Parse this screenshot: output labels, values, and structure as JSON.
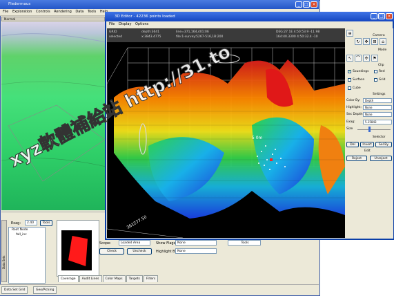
{
  "back_window": {
    "title": "Fledermaus",
    "menu": [
      "File",
      "Exploration",
      "Controls",
      "Rendering",
      "Data",
      "Tools",
      "Help"
    ],
    "strip_label": "Normal"
  },
  "bottom_panel": {
    "exag_label": "Exag:",
    "exag_value": "2.40",
    "tools_button": "Tools",
    "tree_items": [
      "Root Node",
      "fall_inc"
    ],
    "scope_label": "Scope:",
    "scope_value": "Loaded Area",
    "check_button": "Check",
    "uncheck_button": "Uncheck",
    "show_flags_label": "Show Flags:",
    "show_flags_value": "None",
    "highlight_by_label": "Highlight By:",
    "highlight_by_value": "None",
    "tools_dropdown": "Tools",
    "tabs": [
      "Coverage",
      "Audit Lines",
      "Color Maps",
      "Targets",
      "Filters"
    ],
    "side_tab_label": "Data Sets"
  },
  "status_tabs": [
    "Data Set Grid",
    "Geo/Picking"
  ],
  "front_window": {
    "title": "3D Editor - 42236 points loaded",
    "menu": [
      "File",
      "Display",
      "Options"
    ],
    "info": {
      "col1": [
        "GRID",
        "selected"
      ],
      "col2": [
        "depth:3641",
        "x:3843.4775"
      ],
      "col3": [
        "line=371,164,401:06",
        "file:1-survey:5267-516,1B:200"
      ],
      "col4": [
        "DEG:27.1E 4:50:53.9 -11.98",
        "164:40.3300 4:50:32.4 -10"
      ]
    },
    "depth_label": "5 0m",
    "bottom_axis_label": "361277.50"
  },
  "side_panel": {
    "camera_label": "Camera",
    "mode_label": "Mode",
    "clip_label": "Clip",
    "checkboxes": [
      {
        "label": "Soundings",
        "checked": true
      },
      {
        "label": "Red",
        "checked": false
      },
      {
        "label": "Surface",
        "checked": false
      },
      {
        "label": "Grid",
        "checked": false
      },
      {
        "label": "Cube",
        "checked": false
      }
    ],
    "settings_label": "Settings",
    "color_by_label": "Color By:",
    "color_by_value": "Depth",
    "highlight_label": "Highlight:",
    "highlight_value": "None",
    "sec_depth_label": "Sec Depth:",
    "sec_depth_value": "None",
    "exag_label": "Exag:",
    "exag_value": "5.15843",
    "size_label": "Size",
    "selector_label": "Selector",
    "sel_buttons": [
      "Del",
      "Invert",
      "Sel By"
    ],
    "edit_label": "Edit",
    "edit_buttons": [
      "Reject",
      "Unreject"
    ]
  },
  "watermark": "xyz軟體補給站 http://31.to",
  "colors": {
    "titlebar": "#2356c8",
    "window_bg": "#ece9d8",
    "plot_bg": "#000000"
  }
}
